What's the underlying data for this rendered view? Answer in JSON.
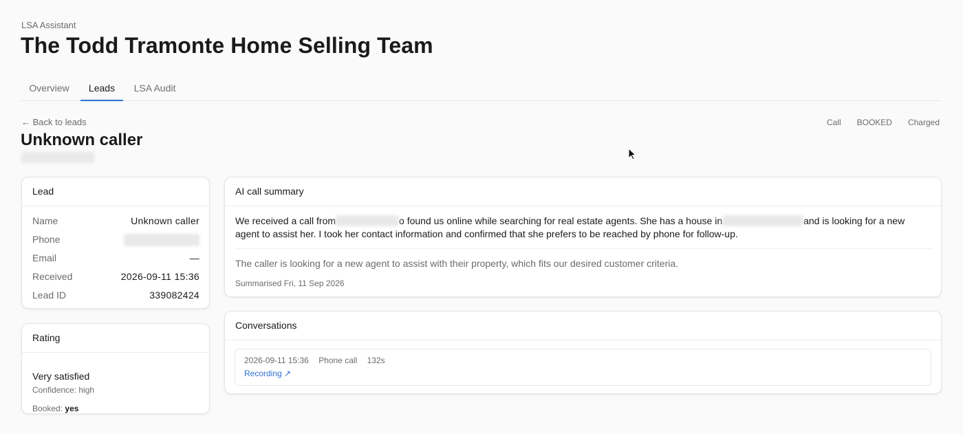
{
  "header": {
    "app_label": "LSA Assistant",
    "title": "The Todd Tramonte Home Selling Team"
  },
  "tabs": [
    {
      "label": "Overview",
      "active": false
    },
    {
      "label": "Leads",
      "active": true
    },
    {
      "label": "LSA Audit",
      "active": false
    }
  ],
  "lead_page": {
    "back_label": "← Back to leads",
    "title": "Unknown caller",
    "tags": [
      "Call",
      "BOOKED",
      "Charged"
    ]
  },
  "lead_card": {
    "title": "Lead",
    "fields": [
      {
        "label": "Name",
        "value": "Unknown caller"
      },
      {
        "label": "Phone",
        "value": ""
      },
      {
        "label": "Email",
        "value": "—"
      },
      {
        "label": "Received",
        "value": "2026-09-11 15:36"
      },
      {
        "label": "Lead ID",
        "value": "339082424"
      }
    ]
  },
  "rating_card": {
    "title": "Rating",
    "rating": "Very satisfied",
    "confidence": "Confidence: high",
    "booked_label": "Booked:",
    "booked_value": "yes"
  },
  "summary_card": {
    "title": "AI call summary",
    "text_part1": "We received a call from",
    "text_part2": "o found us online while searching for real estate agents. She has a house in",
    "text_part3": "and is looking for a new agent to assist her. I took her contact information and confirmed that she prefers to be reached by phone for follow-up.",
    "note": "The caller is looking for a new agent to assist with their property, which fits our desired customer criteria.",
    "date": "Summarised Fri, 11 Sep 2026"
  },
  "conversations_card": {
    "title": "Conversations",
    "items": [
      {
        "datetime": "2026-09-11 15:36",
        "type": "Phone call",
        "duration": "132s",
        "link_label": "Recording ↗"
      }
    ]
  },
  "colors": {
    "accent": "#2f6fd6",
    "background": "#fafafa",
    "muted_text": "#6b6b6b"
  }
}
